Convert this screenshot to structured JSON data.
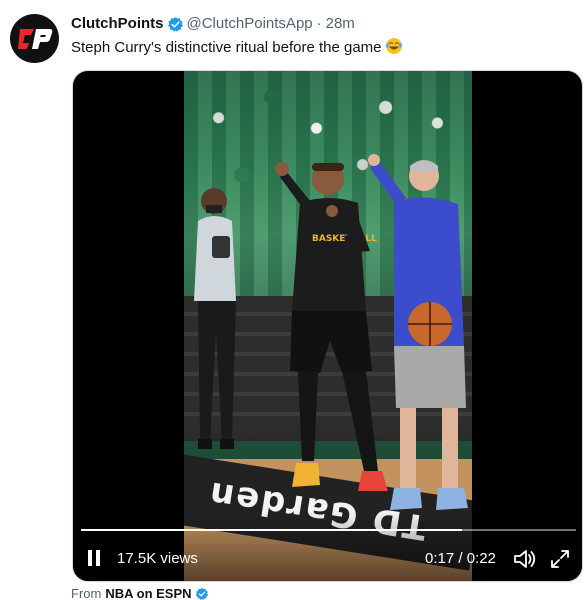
{
  "tweet": {
    "author_name": "ClutchPoints",
    "handle": "@ClutchPointsApp",
    "separator": "·",
    "time": "28m",
    "text": "Steph Curry's distinctive ritual before the game",
    "avatar_letters": "CP",
    "verified_icon": "verified-badge-icon",
    "emoji_icon": "laughing-crying-emoji-icon"
  },
  "video": {
    "views": "17.5K views",
    "time_display": "0:17 / 0:22",
    "progress": 0.77,
    "play_state_icon": "pause-icon",
    "volume_icon": "volume-icon",
    "fullscreen_icon": "fullscreen-icon",
    "court_text": "TD Garden"
  },
  "source": {
    "prefix": "From",
    "name": "NBA on ESPN"
  },
  "colors": {
    "verified_blue": "#1d9bf0",
    "avatar_red": "#e8262b",
    "text_primary": "#0f1419",
    "text_secondary": "#536471"
  }
}
